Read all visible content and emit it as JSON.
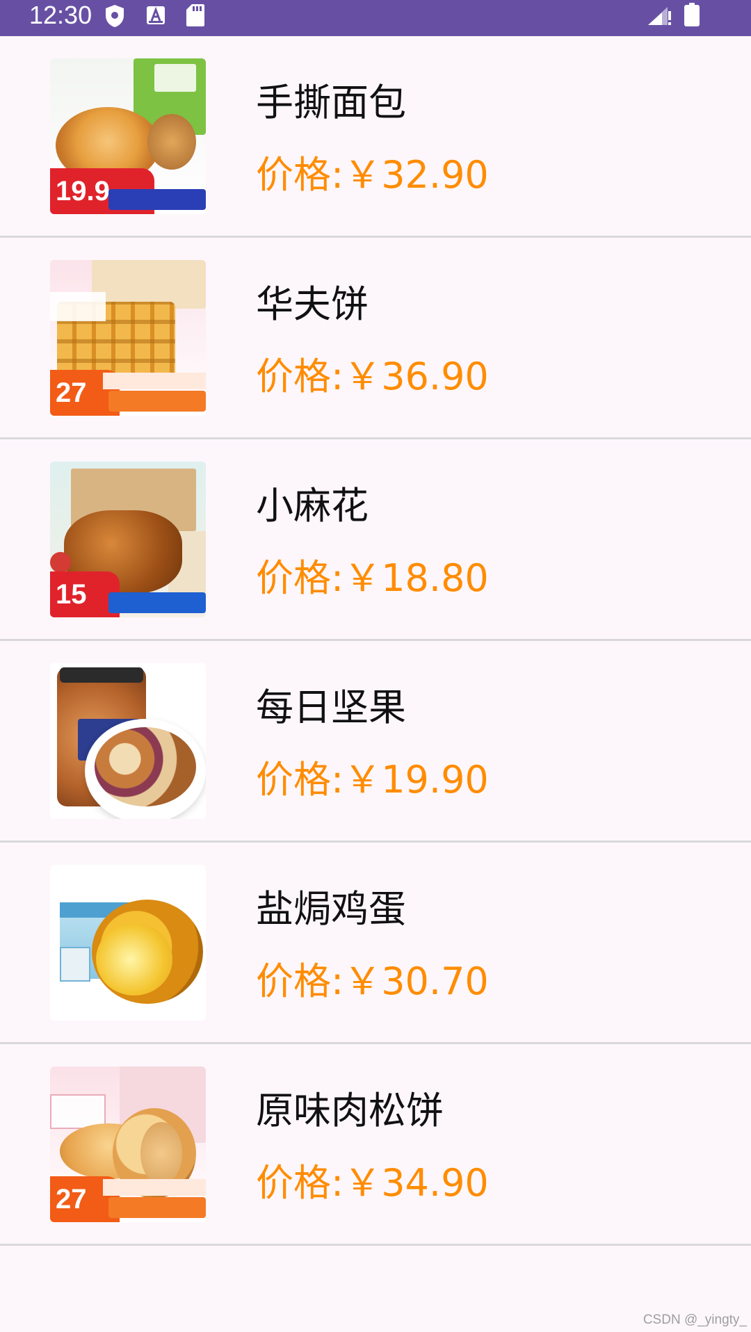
{
  "status_bar": {
    "time": "12:30",
    "icons": [
      "shield-icon",
      "a-letter-icon",
      "sd-card-icon",
      "signal-icon",
      "battery-icon"
    ],
    "background": "#6750a4"
  },
  "colors": {
    "price": "#ff8c00",
    "name": "#111111",
    "divider": "#d9d9d9",
    "background": "#fdf7fc"
  },
  "products": [
    {
      "name": "手撕面包",
      "price_prefix": "价格:",
      "price": "￥32.90"
    },
    {
      "name": "华夫饼",
      "price_prefix": "价格:",
      "price": "￥36.90"
    },
    {
      "name": "小麻花",
      "price_prefix": "价格:",
      "price": "￥18.80"
    },
    {
      "name": "每日坚果",
      "price_prefix": "价格:",
      "price": "￥19.90"
    },
    {
      "name": "盐焗鸡蛋",
      "price_prefix": "价格:",
      "price": "￥30.70"
    },
    {
      "name": "原味肉松饼",
      "price_prefix": "价格:",
      "price": "￥34.90"
    }
  ],
  "watermark": "CSDN @_yingty_"
}
